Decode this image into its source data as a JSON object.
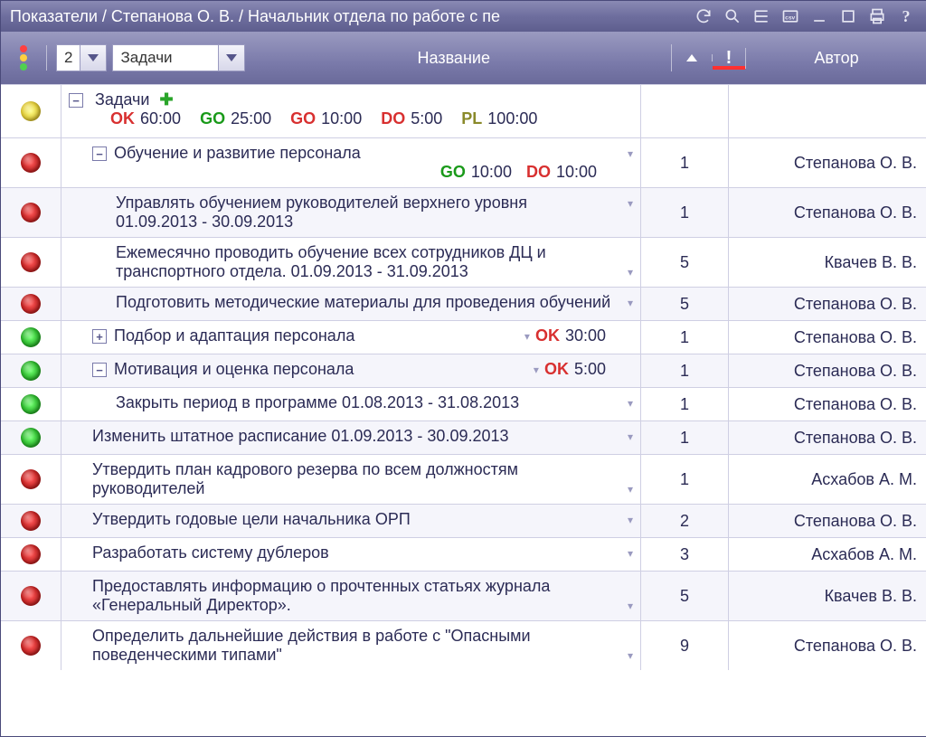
{
  "titlebar": {
    "title": "Показатели / Степанова О. В. / Начальник отдела по работе с пе"
  },
  "header": {
    "level_value": "2",
    "level_dropdown": "Задачи",
    "name_label": "Название",
    "priority_label": "!",
    "author_label": "Автор"
  },
  "summary": {
    "label": "Задачи",
    "ok_time": "60:00",
    "go1_time": "25:00",
    "go2_time": "10:00",
    "do_time": "5:00",
    "pl_time": "100:00"
  },
  "rows": [
    {
      "status": "red",
      "indent": 1,
      "toggle": "minus",
      "title": "Обучение и развитие персонала",
      "sub": [
        {
          "k": "GO",
          "cls": "go-g",
          "v": "10:00"
        },
        {
          "k": "DO",
          "cls": "do",
          "v": "10:00"
        }
      ],
      "pri": "1",
      "author": "Степанова О. В."
    },
    {
      "status": "red",
      "indent": 2,
      "title": "Управлять обучением руководителей верхнего уровня",
      "sub_text": "01.09.2013 - 30.09.2013",
      "pri": "1",
      "author": "Степанова О. В."
    },
    {
      "status": "red",
      "indent": 2,
      "title": "Ежемесячно проводить обучение всех сотрудников ДЦ и транспортного отдела. 01.09.2013 - 31.09.2013",
      "pri": "5",
      "author": "Квачев В. В."
    },
    {
      "status": "red",
      "indent": 2,
      "title": "Подготовить методические материалы для проведения обучений",
      "pri": "5",
      "author": "Степанова О. В."
    },
    {
      "status": "green",
      "indent": 1,
      "toggle": "plus",
      "title": "Подбор и адаптация персонала",
      "inline": [
        {
          "k": "OK",
          "cls": "ok",
          "v": "30:00"
        }
      ],
      "pri": "1",
      "author": "Степанова О. В."
    },
    {
      "status": "green",
      "indent": 1,
      "toggle": "minus",
      "title": "Мотивация и оценка персонала",
      "inline": [
        {
          "k": "OK",
          "cls": "ok",
          "v": "5:00"
        }
      ],
      "pri": "1",
      "author": "Степанова О. В."
    },
    {
      "status": "green",
      "indent": 2,
      "title": "Закрыть период в программе 01.08.2013 - 31.08.2013",
      "pri": "1",
      "author": "Степанова О. В."
    },
    {
      "status": "green",
      "indent": 1,
      "title": "Изменить штатное расписание 01.09.2013 - 30.09.2013",
      "pri": "1",
      "author": "Степанова О. В."
    },
    {
      "status": "red",
      "indent": 1,
      "title": "Утвердить план кадрового резерва по всем должностям руководителей",
      "pri": "1",
      "author": "Асхабов А. М."
    },
    {
      "status": "red",
      "indent": 1,
      "title": "Утвердить годовые цели начальника ОРП",
      "pri": "2",
      "author": "Степанова О. В."
    },
    {
      "status": "red",
      "indent": 1,
      "title": "Разработать систему дублеров",
      "pri": "3",
      "author": "Асхабов А. М."
    },
    {
      "status": "red",
      "indent": 1,
      "title": "Предоставлять информацию о прочтенных статьях журнала «Генеральный Директор».",
      "pri": "5",
      "author": "Квачев В. В."
    },
    {
      "status": "red",
      "indent": 1,
      "title": "Определить дальнейшие действия в работе с \"Опасными поведенческими типами\"",
      "pri": "9",
      "author": "Степанова О. В."
    }
  ]
}
